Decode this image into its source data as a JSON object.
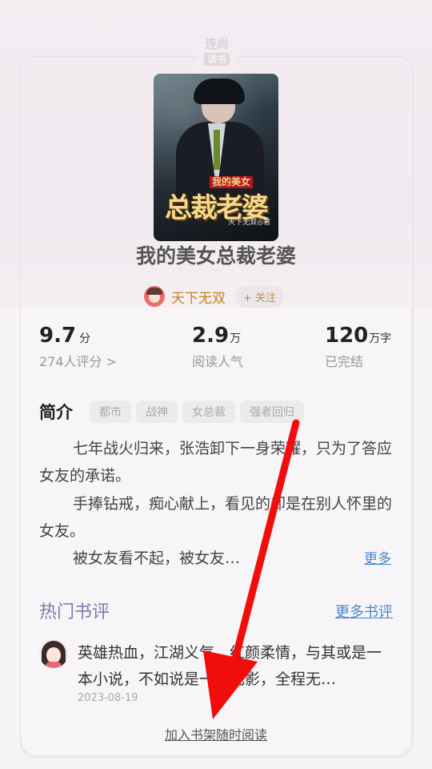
{
  "watermark": {
    "line1": "连尚",
    "line2": "读书"
  },
  "book": {
    "cover_tag": "我的美女",
    "cover_title": "总裁老婆",
    "cover_author": "天下无双◎著",
    "title": "我的美女总裁老婆"
  },
  "author": {
    "name": "天下无双",
    "follow_label": "+ 关注",
    "avatar_icon": "author-avatar-icon"
  },
  "stats": {
    "rating": {
      "value": "9.7",
      "unit": "分",
      "sub": "274人评分 >"
    },
    "popularity": {
      "value": "2.9",
      "unit": "万",
      "sub": "阅读人气"
    },
    "words": {
      "value": "120",
      "unit": "万字",
      "sub": "已完结"
    }
  },
  "intro": {
    "heading": "简介",
    "tags": [
      "都市",
      "战神",
      "女总裁",
      "强者回归"
    ],
    "paragraphs": [
      "七年战火归来，张浩卸下一身荣耀，只为了答应女友的承诺。",
      "手捧钻戒，痴心献上，看见的却是在别人怀里的女友。",
      "被女友看不起，被女友…"
    ],
    "more_label": "更多"
  },
  "reviews": {
    "heading": "热门书评",
    "more_label": "更多书评",
    "items": [
      {
        "text": "英雄热血，江湖义气，红颜柔情，与其或是一本小说，不如说是一部电影，全程无…",
        "date": "2023-08-19"
      }
    ]
  },
  "bottom": {
    "add_to_shelf_label": "加入书架随时阅读"
  },
  "colors": {
    "accent_link": "#4a86c8",
    "author_name": "#c7811e",
    "reviews_heading": "#7b7cb2",
    "arrow": "#f20d0d"
  }
}
